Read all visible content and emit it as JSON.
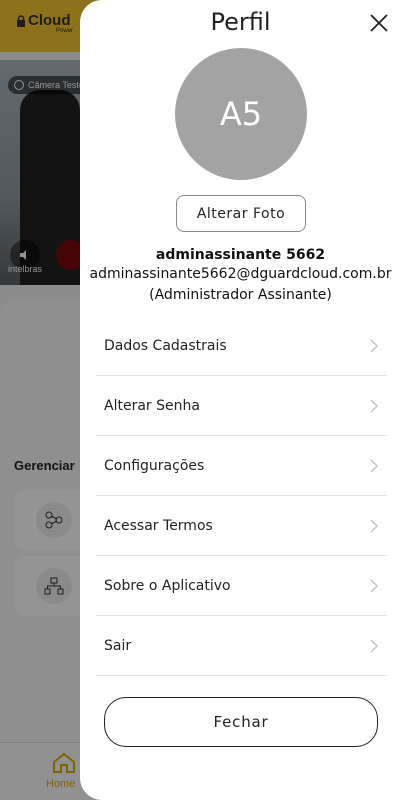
{
  "background": {
    "logo": "Cloud",
    "logo_sub": "Power",
    "camera_chip": "Câmera Teste",
    "brand": "intelbras",
    "manage_label": "Gerenciar",
    "bottom_nav": {
      "home_label": "Home"
    }
  },
  "drawer": {
    "title": "Perfil",
    "avatar_initials": "A5",
    "change_photo_label": "Alterar Foto",
    "user": {
      "name": "adminassinante 5662",
      "email": "adminassinante5662@dguardcloud.com.br",
      "role": "(Administrador Assinante)"
    },
    "menu": [
      {
        "label": "Dados Cadastrais"
      },
      {
        "label": "Alterar Senha"
      },
      {
        "label": "Configurações"
      },
      {
        "label": "Acessar Termos"
      },
      {
        "label": "Sobre o Aplicativo"
      },
      {
        "label": "Sair"
      }
    ],
    "close_label": "Fechar"
  },
  "colors": {
    "accent": "#f4c430",
    "avatar_bg": "#a3a3a3",
    "divider": "#e2e2e2",
    "overlay": "rgba(0,0,0,0.42)"
  }
}
